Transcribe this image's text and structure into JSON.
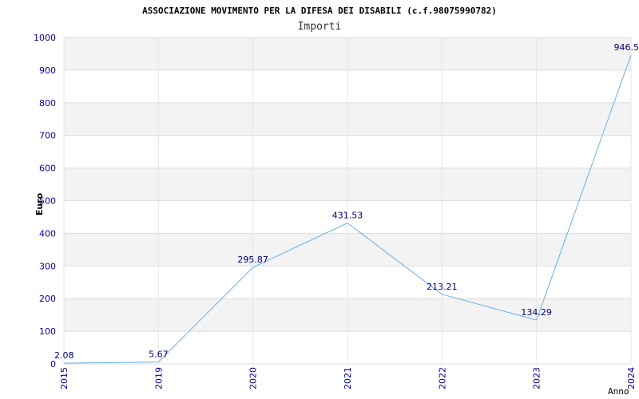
{
  "chart_data": {
    "type": "line",
    "title": "ASSOCIAZIONE MOVIMENTO PER LA DIFESA DEI DISABILI (c.f.98075990782)",
    "subtitle": "Importi",
    "xlabel": "Anno",
    "ylabel": "Euro",
    "categories": [
      "2015",
      "2019",
      "2020",
      "2021",
      "2022",
      "2023",
      "2024"
    ],
    "values": [
      2.08,
      5.67,
      295.87,
      431.53,
      213.21,
      134.29,
      946.5
    ],
    "data_labels": [
      "2.08",
      "5.67",
      "295.87",
      "431.53",
      "213.21",
      "134.29",
      "946.5"
    ],
    "ylim": [
      0,
      1000
    ],
    "yticks": [
      0,
      100,
      200,
      300,
      400,
      500,
      600,
      700,
      800,
      900,
      1000
    ],
    "grid": "horizontal bands",
    "colors": {
      "line": "#6aaee8",
      "band": "#f3f3f3",
      "gridline": "#dddddd",
      "tick_label": "#0000a0",
      "data_label": "#000080",
      "title": "#000000"
    }
  }
}
